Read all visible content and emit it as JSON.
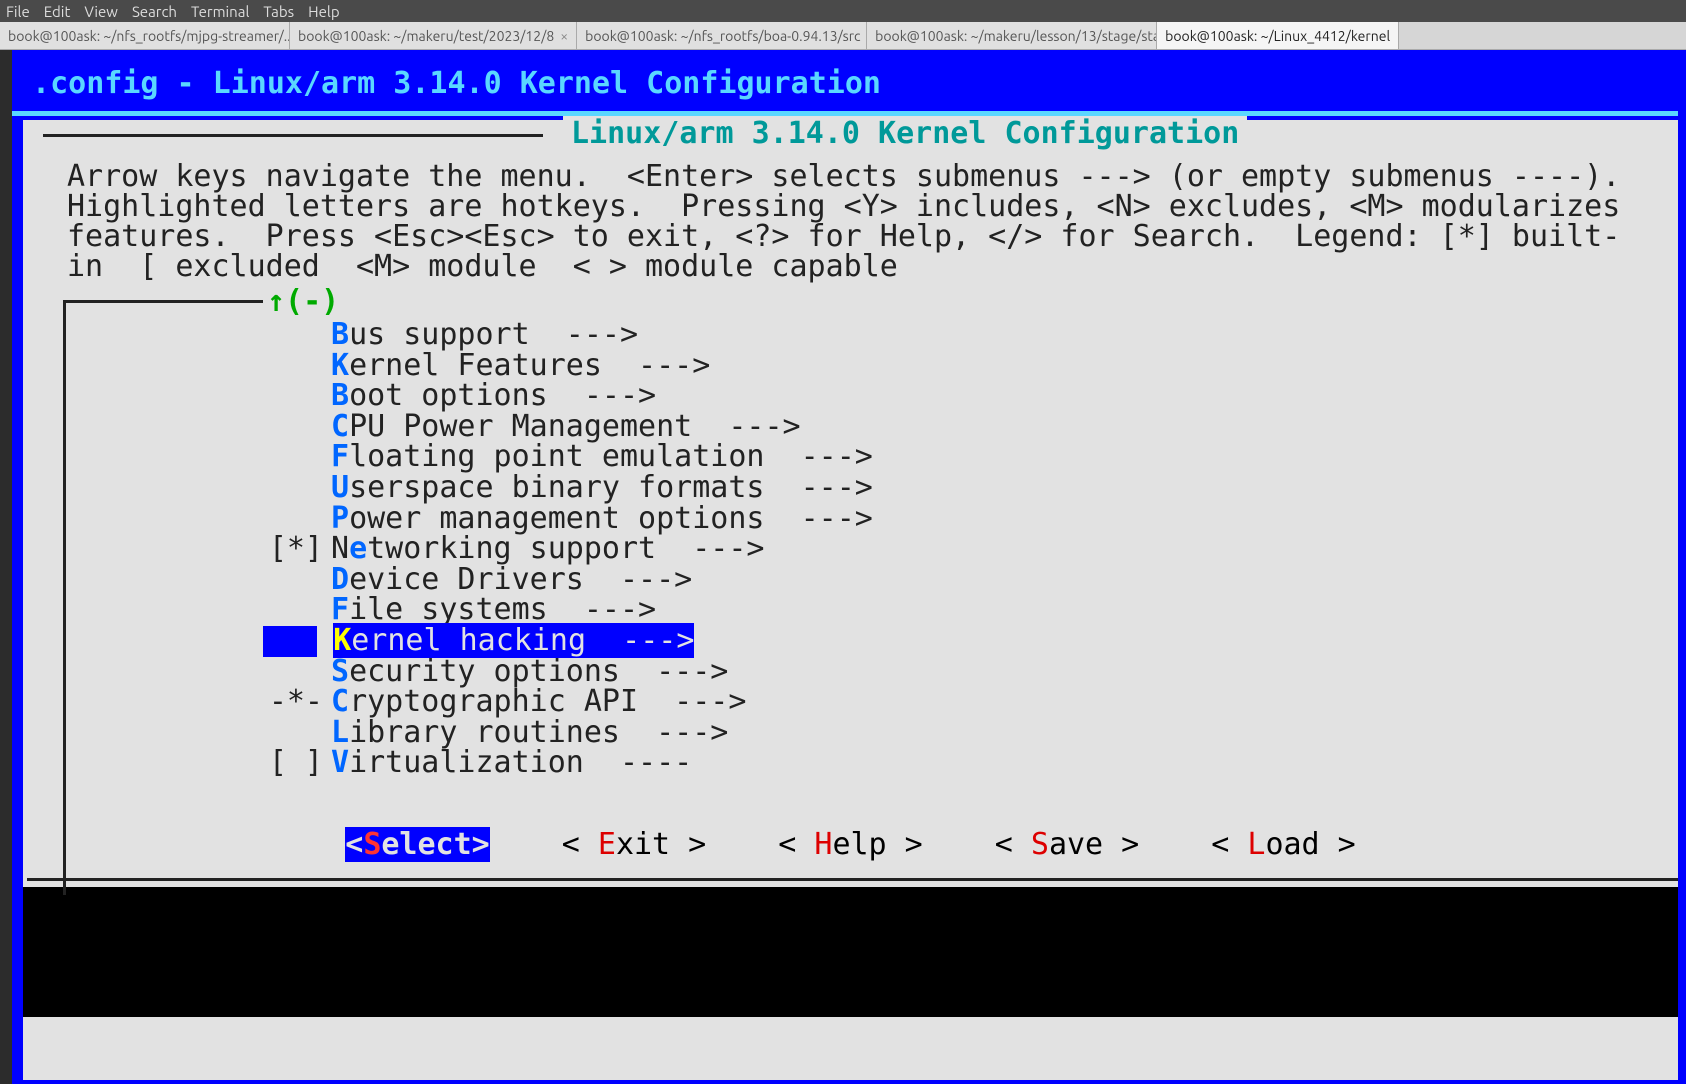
{
  "menubar": [
    "File",
    "Edit",
    "View",
    "Search",
    "Terminal",
    "Tabs",
    "Help"
  ],
  "tabs": [
    {
      "label": "book@100ask: ~/nfs_rootfs/mjpg-streamer/...",
      "active": false,
      "closable": true
    },
    {
      "label": "book@100ask: ~/makeru/test/2023/12/8",
      "active": false,
      "closable": true
    },
    {
      "label": "book@100ask: ~/nfs_rootfs/boa-0.94.13/src",
      "active": false,
      "closable": true
    },
    {
      "label": "book@100ask: ~/makeru/lesson/13/stage/sta...",
      "active": false,
      "closable": true
    },
    {
      "label": "book@100ask: ~/Linux_4412/kernel",
      "active": true,
      "closable": false
    }
  ],
  "title": " .config - Linux/arm 3.14.0 Kernel Configuration",
  "dialog_title": "Linux/arm 3.14.0 Kernel Configuration",
  "help_text": "Arrow keys navigate the menu.  <Enter> selects submenus ---> (or empty submenus ----). Highlighted letters are hotkeys.  Pressing <Y> includes, <N> excludes, <M> modularizes features.  Press <Esc><Esc> to exit, <?> for Help, </> for Search.  Legend: [*] built-in  [ excluded  <M> module  < > module capable",
  "scroll_indicator": "↑(-)",
  "menu": [
    {
      "prefix": "   ",
      "hotkey": "B",
      "rest": "us support  --->",
      "selected": false
    },
    {
      "prefix": "   ",
      "hotkey": "K",
      "rest": "ernel Features  --->",
      "selected": false
    },
    {
      "prefix": "   ",
      "hotkey": "B",
      "rest": "oot options  --->",
      "selected": false
    },
    {
      "prefix": "   ",
      "hotkey": "C",
      "rest": "PU Power Management  --->",
      "selected": false
    },
    {
      "prefix": "   ",
      "hotkey": "F",
      "rest": "loating point emulation  --->",
      "selected": false
    },
    {
      "prefix": "   ",
      "hotkey": "U",
      "rest": "serspace binary formats  --->",
      "selected": false
    },
    {
      "prefix": "   ",
      "hotkey": "P",
      "rest": "ower management options  --->",
      "selected": false
    },
    {
      "prefix": "[*]",
      "hotkey": "N",
      "rest": "etworking support  --->",
      "selected": false,
      "hk2": "e",
      "pre2": "N"
    },
    {
      "prefix": "   ",
      "hotkey": "D",
      "rest": "evice Drivers  --->",
      "selected": false
    },
    {
      "prefix": "   ",
      "hotkey": "F",
      "rest": "ile systems  --->",
      "selected": false
    },
    {
      "prefix": "   ",
      "hotkey": "K",
      "rest": "ernel hacking  --->",
      "selected": true
    },
    {
      "prefix": "   ",
      "hotkey": "S",
      "rest": "ecurity options  --->",
      "selected": false
    },
    {
      "prefix": "-*-",
      "hotkey": "C",
      "rest": "ryptographic API  --->",
      "selected": false
    },
    {
      "prefix": "   ",
      "hotkey": "L",
      "rest": "ibrary routines  --->",
      "selected": false
    },
    {
      "prefix": "[ ]",
      "hotkey": "V",
      "rest": "irtualization  ----",
      "selected": false
    }
  ],
  "buttons": [
    {
      "pre": "<",
      "hk": "S",
      "rest": "elect>",
      "selected": true
    },
    {
      "pre": "< ",
      "hk": "E",
      "rest": "xit >",
      "selected": false
    },
    {
      "pre": "< ",
      "hk": "H",
      "rest": "elp >",
      "selected": false
    },
    {
      "pre": "< ",
      "hk": "S",
      "rest": "ave >",
      "selected": false
    },
    {
      "pre": "< ",
      "hk": "L",
      "rest": "oad >",
      "selected": false
    }
  ]
}
